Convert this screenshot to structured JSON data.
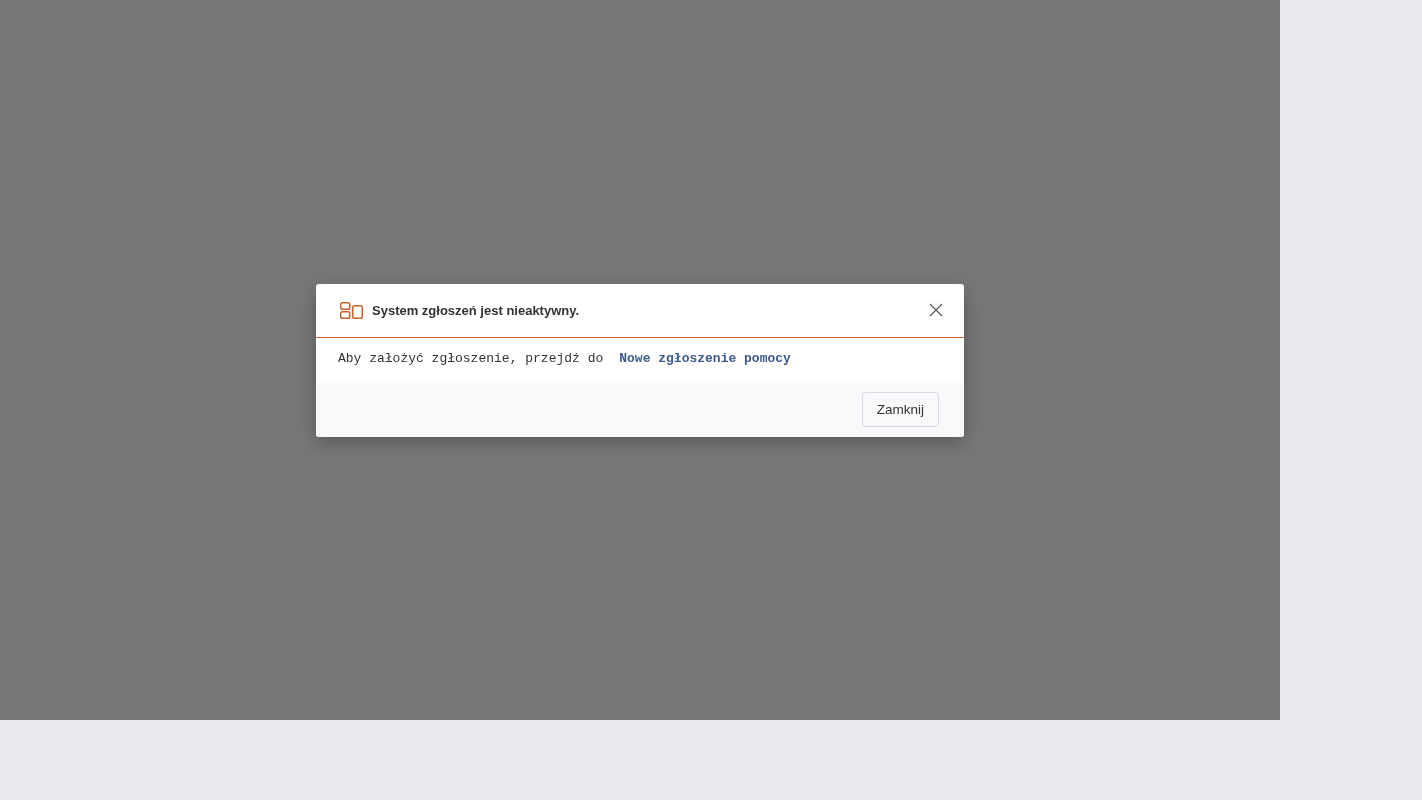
{
  "dialog": {
    "title": "System zgłoszeń jest nieaktywny.",
    "message": "Aby założyć zgłoszenie, przejdź do",
    "link": "Nowe zgłoszenie pomocy",
    "buttons": [
      "Zamknij"
    ]
  }
}
